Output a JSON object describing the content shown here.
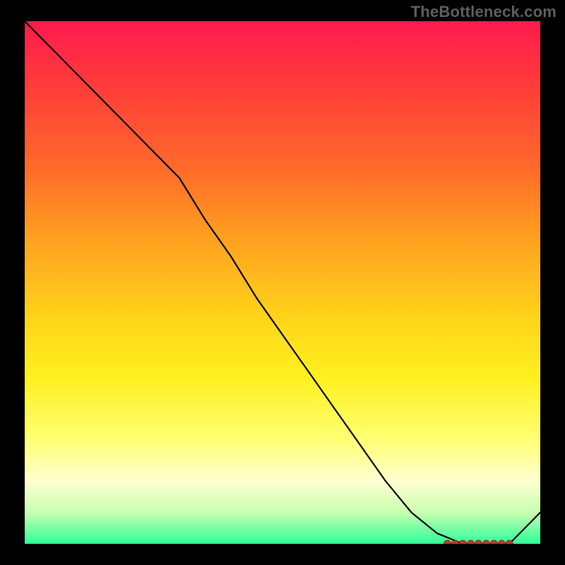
{
  "watermark": "TheBottleneck.com",
  "colors": {
    "page_bg": "#000000",
    "watermark_text": "#5e5e5e",
    "line": "#000000",
    "marker_fill": "#c0392b",
    "marker_stroke": "#8a2a1f"
  },
  "chart_data": {
    "type": "line",
    "title": "",
    "xlabel": "",
    "ylabel": "",
    "xlim": [
      0,
      100
    ],
    "ylim": [
      0,
      100
    ],
    "grid": false,
    "legend": false,
    "x": [
      0,
      5,
      10,
      15,
      20,
      25,
      30,
      35,
      40,
      45,
      50,
      55,
      60,
      65,
      70,
      75,
      80,
      85,
      88,
      91,
      94,
      100
    ],
    "y": [
      100,
      95,
      90,
      85,
      80,
      75,
      70,
      62,
      55,
      47,
      40,
      33,
      26,
      19,
      12,
      6,
      2,
      0,
      0,
      0,
      0,
      6
    ],
    "markers": {
      "x": [
        82,
        83.5,
        85,
        86.5,
        88,
        89.5,
        91,
        92.5,
        94
      ],
      "y": [
        0,
        0,
        0,
        0,
        0,
        0,
        0,
        0,
        0
      ]
    },
    "gradient_stops": [
      {
        "pos": 0,
        "color": "#ff1a4d"
      },
      {
        "pos": 12,
        "color": "#ff3b3b"
      },
      {
        "pos": 28,
        "color": "#ff6a2a"
      },
      {
        "pos": 42,
        "color": "#ffa21f"
      },
      {
        "pos": 56,
        "color": "#ffd21a"
      },
      {
        "pos": 68,
        "color": "#fff01e"
      },
      {
        "pos": 80,
        "color": "#ffff73"
      },
      {
        "pos": 88,
        "color": "#ffffd0"
      },
      {
        "pos": 94,
        "color": "#c8ffb0"
      },
      {
        "pos": 100,
        "color": "#2cff9a"
      }
    ]
  }
}
